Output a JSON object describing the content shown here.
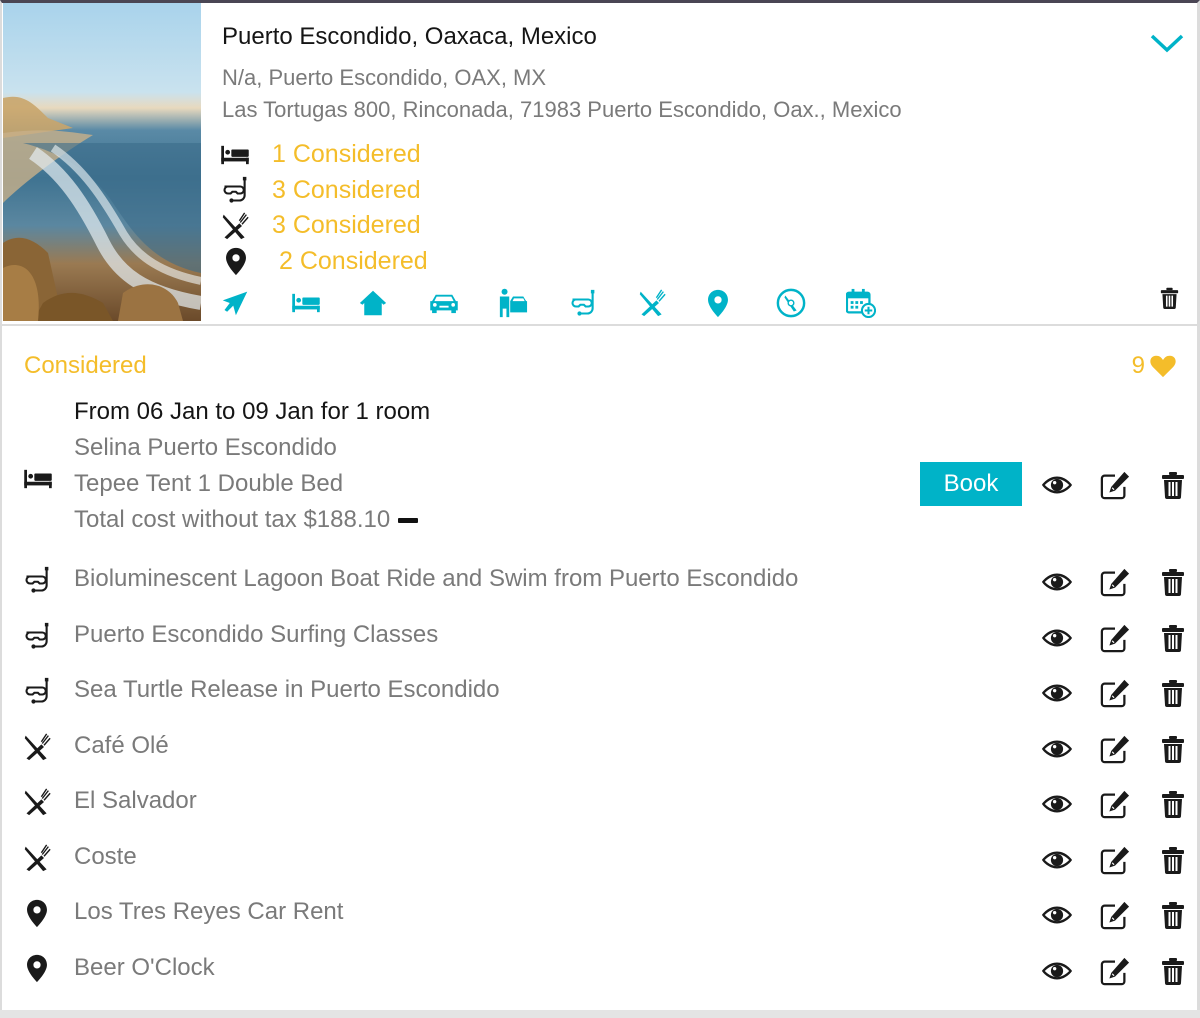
{
  "destination": {
    "title": "Puerto Escondido, Oaxaca, Mexico",
    "subtitle": "N/a, Puerto Escondido, OAX, MX",
    "address": "Las Tortugas 800, Rinconada, 71983 Puerto Escondido, Oax., Mexico",
    "photo_alt": "beach-photo",
    "expand_icon": "chevron-down-icon",
    "counts": [
      {
        "icon": "bed-icon",
        "label": "1 Considered"
      },
      {
        "icon": "snorkel-icon",
        "label": "3 Considered"
      },
      {
        "icon": "restaurant-icon",
        "label": "3 Considered"
      },
      {
        "icon": "map-pin-icon",
        "label": "2 Considered"
      }
    ],
    "add_toolbar": [
      {
        "icon": "flight-icon",
        "label": "Flights"
      },
      {
        "icon": "bed-icon",
        "label": "Hotels"
      },
      {
        "icon": "home-icon",
        "label": "Rentals"
      },
      {
        "icon": "car-icon",
        "label": "Car rental"
      },
      {
        "icon": "driver-icon",
        "label": "Transfers"
      },
      {
        "icon": "snorkel-icon",
        "label": "Activities"
      },
      {
        "icon": "restaurant-icon",
        "label": "Restaurants"
      },
      {
        "icon": "map-pin-icon",
        "label": "Places"
      },
      {
        "icon": "compass-icon",
        "label": "Explore"
      },
      {
        "icon": "calendar-add-icon",
        "label": "Add event"
      }
    ],
    "delete_icon": "trash-icon"
  },
  "considered": {
    "title": "Considered",
    "favorites_count": "9",
    "hotel": {
      "dates": "From 06 Jan to 09 Jan for 1 room",
      "name": "Selina Puerto Escondido",
      "room": "Tepee Tent 1 Double Bed",
      "cost": "Total cost without tax $188.10",
      "book_label": "Book"
    },
    "items": [
      {
        "icon": "snorkel-icon",
        "name": "Bioluminescent Lagoon Boat Ride and Swim from Puerto Escondido"
      },
      {
        "icon": "snorkel-icon",
        "name": "Puerto Escondido Surfing Classes"
      },
      {
        "icon": "snorkel-icon",
        "name": "Sea Turtle Release in Puerto Escondido"
      },
      {
        "icon": "restaurant-icon",
        "name": "Café Olé"
      },
      {
        "icon": "restaurant-icon",
        "name": "El Salvador"
      },
      {
        "icon": "restaurant-icon",
        "name": "Coste"
      },
      {
        "icon": "map-pin-icon",
        "name": "Los Tres Reyes Car Rent"
      },
      {
        "icon": "map-pin-icon",
        "name": "Beer O'Clock"
      }
    ]
  },
  "colors": {
    "accent": "#00b3c8",
    "highlight": "#f4bd2a",
    "text_primary": "#151515",
    "text_secondary": "#7a7a7a"
  }
}
